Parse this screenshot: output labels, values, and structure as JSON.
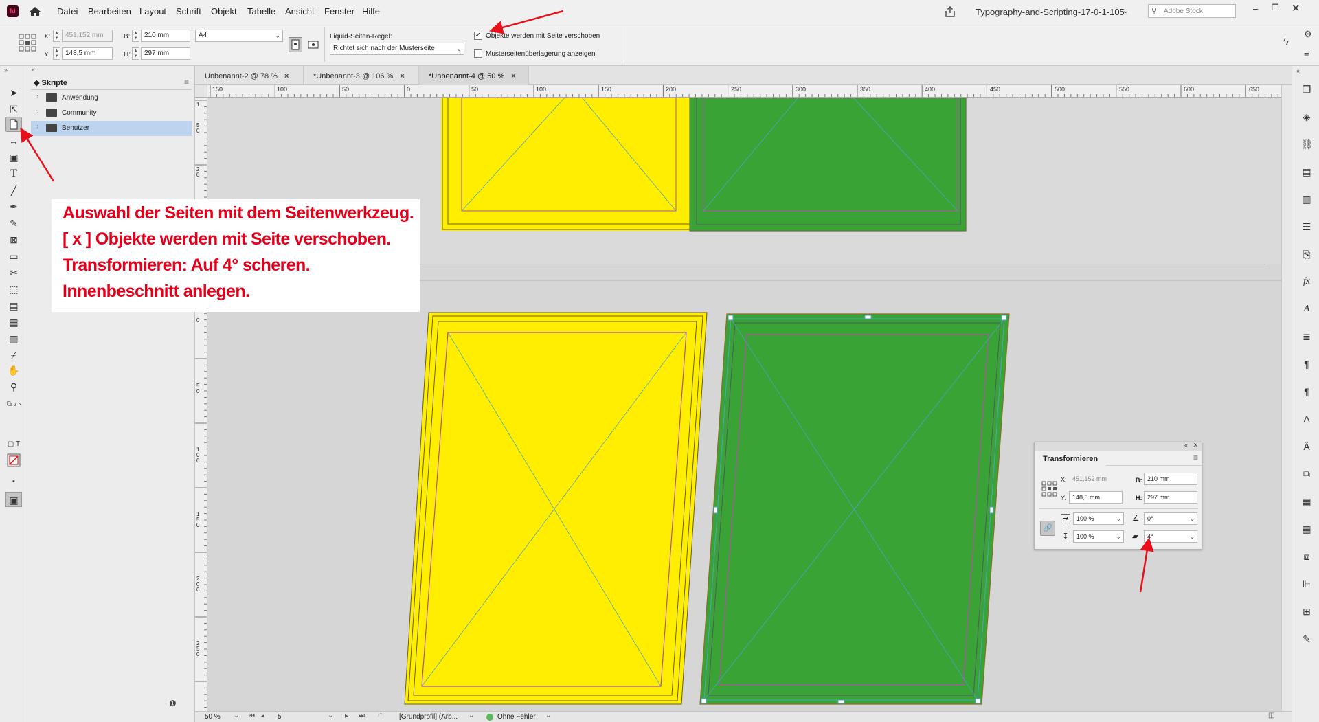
{
  "app": {
    "logo_text": "Id"
  },
  "menu": {
    "items": [
      "Datei",
      "Bearbeiten",
      "Layout",
      "Schrift",
      "Objekt",
      "Tabelle",
      "Ansicht",
      "Fenster",
      "Hilfe"
    ],
    "doc_title": "Typography-and-Scripting-17-0-1-105",
    "search_placeholder": "Adobe Stock"
  },
  "control": {
    "x_label": "X:",
    "x_value": "451,152 mm",
    "y_label": "Y:",
    "y_value": "148,5 mm",
    "w_label": "B:",
    "w_value": "210 mm",
    "h_label": "H:",
    "h_value": "297 mm",
    "preset": "A4",
    "liquid_label": "Liquid-Seiten-Regel:",
    "liquid_value": "Richtet sich nach der Musterseite",
    "chk1_label": "Objekte werden mit Seite verschoben",
    "chk1_checked": true,
    "chk2_label": "Musterseitenüberlagerung anzeigen",
    "chk2_checked": false
  },
  "scripts_panel": {
    "title": "Skripte",
    "items": [
      {
        "label": "Anwendung",
        "selected": false
      },
      {
        "label": "Community",
        "selected": false
      },
      {
        "label": "Benutzer",
        "selected": true
      }
    ]
  },
  "doc_tabs": [
    {
      "label": "Unbenannt-2 @ 78 %",
      "active": false
    },
    {
      "label": "*Unbenannt-3 @ 106 %",
      "active": false
    },
    {
      "label": "*Unbenannt-4 @ 50 %",
      "active": true
    }
  ],
  "ruler": {
    "h_ticks": [
      "150",
      "100",
      "50",
      "0",
      "50",
      "100",
      "150",
      "200",
      "250",
      "300",
      "350",
      "400",
      "450",
      "500",
      "550",
      "600",
      "650"
    ],
    "v_ticks_top": [
      "1",
      "5",
      "0",
      "2",
      "0"
    ],
    "v_ticks_bottom": [
      "0",
      "5",
      "0",
      "1",
      "0",
      "0",
      "1",
      "5",
      "0",
      "2",
      "0",
      "0",
      "2",
      "5",
      "0"
    ]
  },
  "annotation": {
    "lines": [
      "Auswahl der Seiten mit dem Seitenwerkzeug.",
      "[ x ] Objekte werden mit Seite verschoben.",
      "Transformieren: Auf 4° scheren.",
      "Innenbeschnitt anlegen."
    ]
  },
  "transform_panel": {
    "title": "Transformieren",
    "x_label": "X:",
    "x_value": "451,152 mm",
    "y_label": "Y:",
    "y_value": "148,5 mm",
    "w_label": "B:",
    "w_value": "210 mm",
    "h_label": "H:",
    "h_value": "297 mm",
    "scale_x": "100 %",
    "scale_y": "100 %",
    "rotation": "0°",
    "shear": "4°"
  },
  "status": {
    "zoom": "50 %",
    "page": "5",
    "profile": "[Grundprofil] (Arb...",
    "errors": "Ohne Fehler"
  },
  "colors": {
    "yellow_page": "#ffee00",
    "green_page": "#3aa335",
    "annotation_red": "#e3001b",
    "arrow_red": "#e8101a",
    "margin_guide": "#b04fa8",
    "frame_line": "#4ba3c7"
  }
}
